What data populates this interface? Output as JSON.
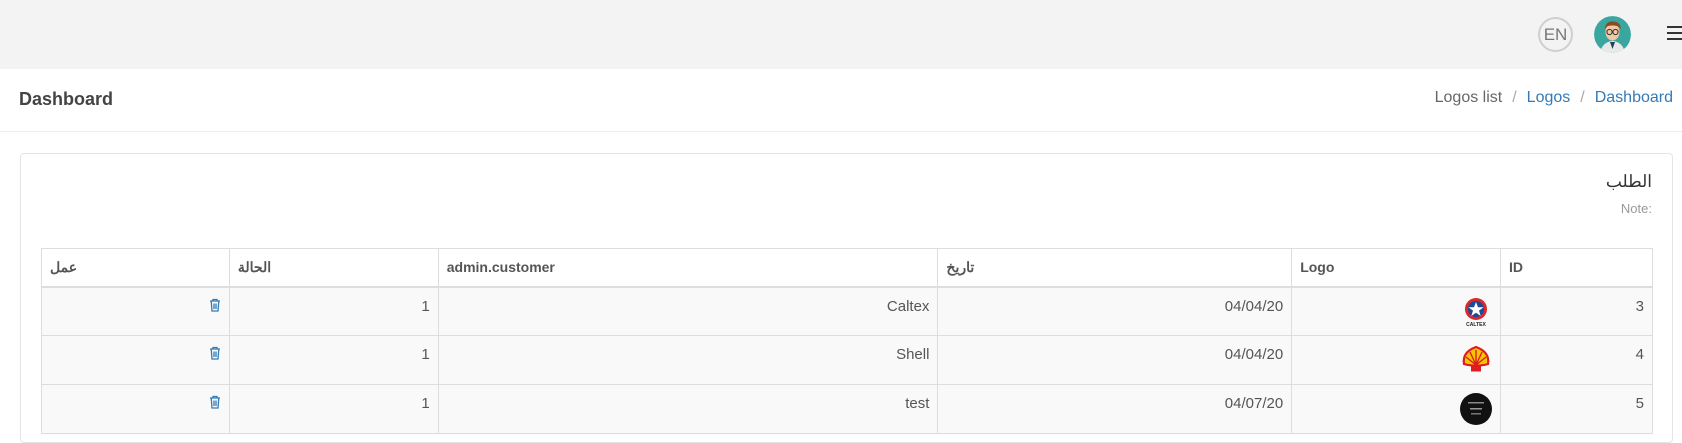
{
  "topbar": {
    "lang_label": "EN",
    "icons": {
      "avatar": "user-avatar",
      "menu": "hamburger-menu-icon"
    }
  },
  "header": {
    "title": "Dashboard",
    "breadcrumb": [
      "Logos list",
      "Logos",
      "Dashboard"
    ]
  },
  "card": {
    "title": "الطلب",
    "note": "Note:"
  },
  "table": {
    "headers": [
      "عمل",
      "الحالة",
      "admin.customer",
      "تاريخ",
      "Logo",
      "ID"
    ],
    "rows": [
      {
        "action": "delete",
        "status": "1",
        "customer": "Caltex",
        "date": "04/04/20",
        "logo": "caltex-logo",
        "id": "3"
      },
      {
        "action": "delete",
        "status": "1",
        "customer": "Shell",
        "date": "04/04/20",
        "logo": "shell-logo",
        "id": "4"
      },
      {
        "action": "delete",
        "status": "1",
        "customer": "test",
        "date": "04/07/20",
        "logo": "dark-circle-logo",
        "id": "5"
      }
    ]
  },
  "colors": {
    "link": "#337ab7",
    "topbar": "#f3f3f3",
    "trash": "#337ab7"
  }
}
